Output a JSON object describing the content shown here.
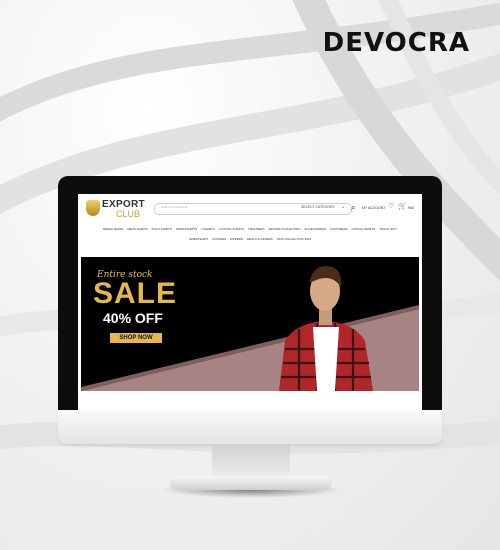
{
  "brand": {
    "name": "DEVOCRA"
  },
  "site": {
    "logo": {
      "line1": "EXPORT",
      "line2": "CLUB"
    },
    "search": {
      "placeholder": "Search for products",
      "category": "SELECT CATEGORY"
    },
    "account": "MY ACCOUNT",
    "cart_price": "Rs0"
  },
  "nav": {
    "row1": [
      "DENIM JEANS",
      "MENS SHIRTS",
      "POLO SHIRTS",
      "SWEATSHIRTS",
      "T-SHIRTS",
      "COTTON CHINOS",
      "TROUSERS",
      "WINTER COLLECTION",
      "ACCESSORIES",
      "FOOTWEAR",
      "CASUAL SHIRTS",
      "TRACK SUIT"
    ],
    "row2": [
      "SWEATSHIRT",
      "HOODIES",
      "ZIPPERS",
      "DEALS & OFFERS",
      "KIDS COLLECTION 2023"
    ]
  },
  "banner": {
    "tag": "Entire stock",
    "headline": "SALE",
    "discount": "40% OFF",
    "cta": "SHOP NOW"
  },
  "icons": {
    "search": "search-icon",
    "wishlist": "heart-icon",
    "cart": "cart-icon",
    "dropdown": "chevron-down-icon"
  },
  "colors": {
    "gold": "#e6b84a",
    "banner_bg": "#000000",
    "banner_panel": "#a88383",
    "monitor_bezel": "#0d0d0d"
  }
}
